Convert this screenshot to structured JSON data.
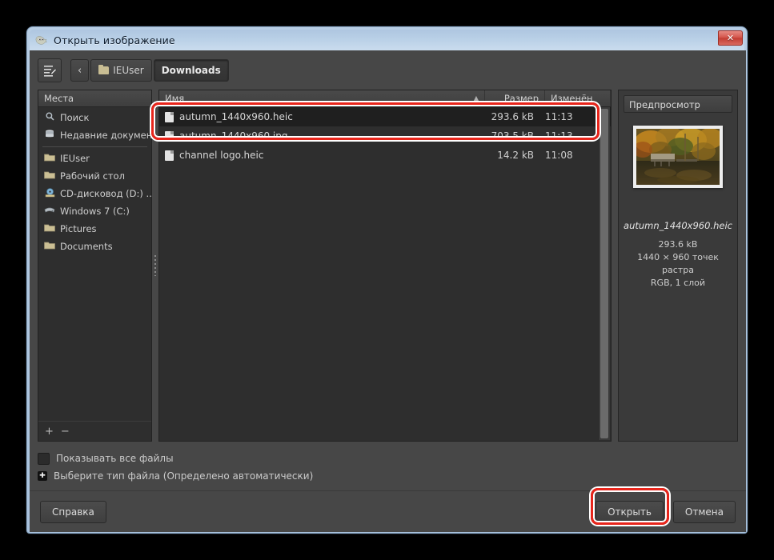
{
  "window": {
    "title": "Открыть изображение",
    "app_icon": "wilber-icon",
    "close_label": "✕"
  },
  "pathbar": {
    "location_button_icon": "type-location-icon",
    "back_icon": "‹",
    "crumbs": [
      {
        "label": "IEUser",
        "icon": "folder-icon",
        "active": false
      },
      {
        "label": "Downloads",
        "icon": "",
        "active": true
      }
    ]
  },
  "places": {
    "header": "Места",
    "items": [
      {
        "label": "Поиск",
        "icon": "search-icon",
        "glyph": "◌"
      },
      {
        "label": "Недавние докумен...",
        "icon": "recent-icon",
        "glyph": "▤"
      },
      {
        "label": "IEUser",
        "icon": "folder-icon",
        "glyph": ""
      },
      {
        "label": "Рабочий стол",
        "icon": "folder-icon",
        "glyph": ""
      },
      {
        "label": "CD-дисковод (D:) ...",
        "icon": "cd-drive-icon",
        "glyph": "◉"
      },
      {
        "label": "Windows 7 (C:)",
        "icon": "hard-drive-icon",
        "glyph": "▰"
      },
      {
        "label": "Pictures",
        "icon": "folder-icon",
        "glyph": ""
      },
      {
        "label": "Documents",
        "icon": "folder-icon",
        "glyph": ""
      }
    ],
    "add_label": "+",
    "remove_label": "−"
  },
  "filelist": {
    "columns": {
      "name": "Имя",
      "size": "Размер",
      "modified": "Изменён"
    },
    "sort_arrow": "▲",
    "rows": [
      {
        "name": "autumn_1440x960.heic",
        "size": "293.6 kB",
        "modified": "11:13",
        "selected": true
      },
      {
        "name": "autumn_1440x960.jpg",
        "size": "703.5 kB",
        "modified": "11:13",
        "selected": false
      },
      {
        "name": "channel logo.heic",
        "size": "14.2 kB",
        "modified": "11:08",
        "selected": false
      }
    ]
  },
  "preview": {
    "header": "Предпросмотр",
    "filename": "autumn_1440x960.heic",
    "size": "293.6 kB",
    "dimensions": "1440 × 960 точек растра",
    "colormode": "RGB, 1 слой"
  },
  "options": {
    "show_all_files": "Показывать все файлы",
    "select_file_type": "Выберите тип файла (Определено автоматически)",
    "expander_glyph": "✚"
  },
  "actions": {
    "help": "Справка",
    "open": "Открыть",
    "cancel": "Отмена"
  },
  "annotation_color": "#e8251b"
}
